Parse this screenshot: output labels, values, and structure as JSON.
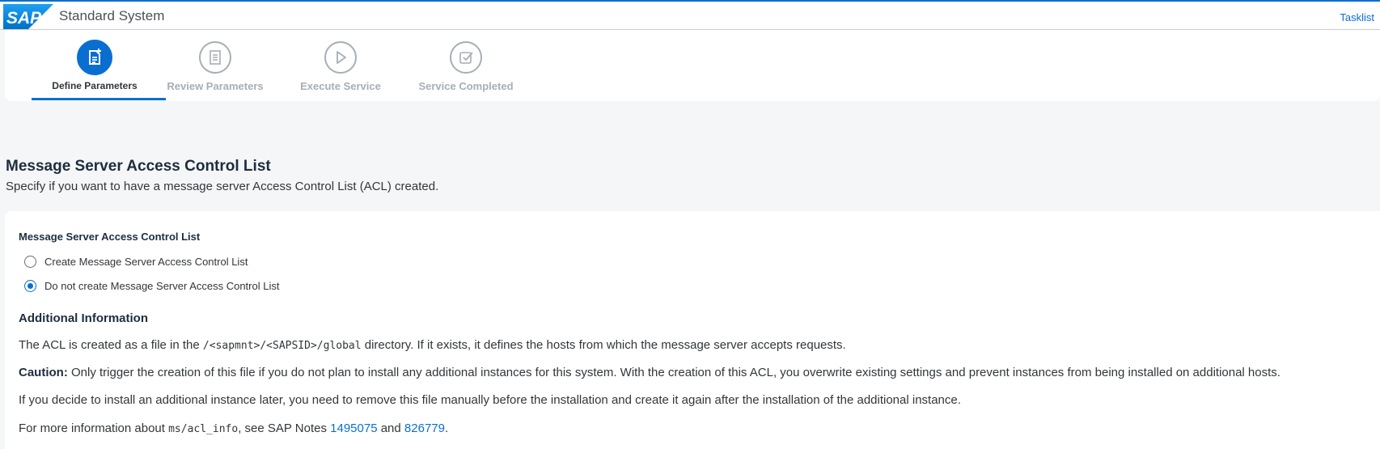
{
  "shell": {
    "logo_text": "SAP",
    "title": "Standard System",
    "tasklist_label": "Tasklist"
  },
  "wizard": {
    "steps": [
      {
        "label": "Define Parameters",
        "icon": "edit-document-icon",
        "active": true
      },
      {
        "label": "Review Parameters",
        "icon": "checklist-icon",
        "active": false
      },
      {
        "label": "Execute Service",
        "icon": "play-icon",
        "active": false
      },
      {
        "label": "Service Completed",
        "icon": "checkbox-done-icon",
        "active": false
      }
    ]
  },
  "page": {
    "title": "Message Server Access Control List",
    "subtitle": "Specify if you want to have a message server Access Control List (ACL) created."
  },
  "form": {
    "group_label": "Message Server Access Control List",
    "options": [
      {
        "label": "Create Message Server Access Control List",
        "selected": false
      },
      {
        "label": "Do not create Message Server Access Control List",
        "selected": true
      }
    ]
  },
  "info": {
    "heading": "Additional Information",
    "p1_before": "The ACL is created as a file in the ",
    "p1_code": "/<sapmnt>/<SAPSID>/global",
    "p1_after": " directory. If it exists, it defines the hosts from which the message server accepts requests.",
    "p2_bold": "Caution:",
    "p2_text": " Only trigger the creation of this file if you do not plan to install any additional instances for this system. With the creation of this ACL, you overwrite existing settings and prevent instances from being installed on additional hosts.",
    "p3": "If you decide to install an additional instance later, you need to remove this file manually before the installation and create it again after the installation of the additional instance.",
    "p4_before": "For more information about ",
    "p4_code": "ms/acl_info",
    "p4_mid": ", see SAP Notes ",
    "note1": "1495075",
    "p4_and": " and ",
    "note2": "826779",
    "p4_end": "."
  },
  "colors": {
    "accent": "#0a6ed1",
    "background": "#f5f6f7",
    "inactive_step": "#a6aeb6"
  }
}
